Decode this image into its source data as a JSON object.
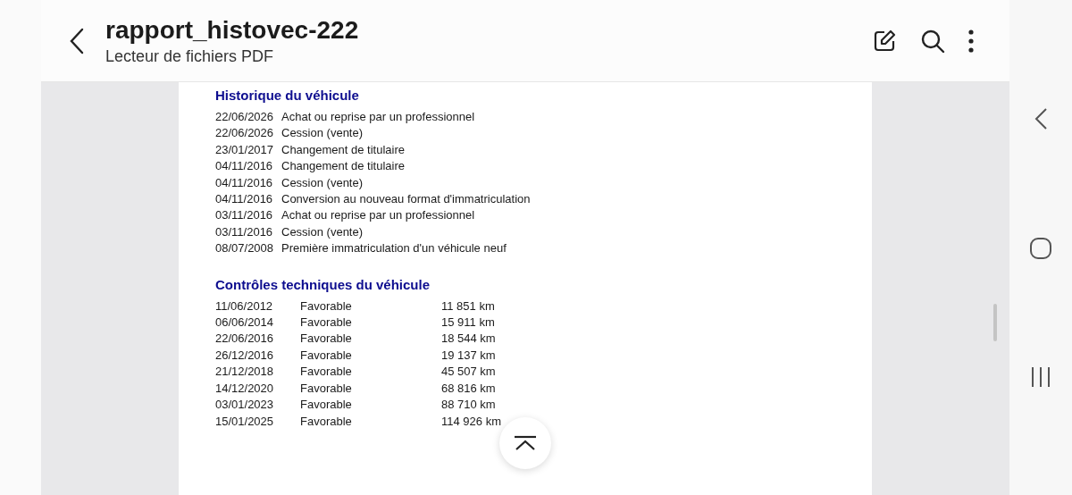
{
  "header": {
    "title": "rapport_histovec-222",
    "subtitle": "Lecteur de fichiers PDF"
  },
  "history": {
    "title": "Historique du véhicule",
    "rows": [
      {
        "date": "22/06/2026",
        "event": "Achat ou reprise par un professionnel"
      },
      {
        "date": "22/06/2026",
        "event": "Cession (vente)"
      },
      {
        "date": "23/01/2017",
        "event": "Changement de titulaire"
      },
      {
        "date": "04/11/2016",
        "event": "Changement de titulaire"
      },
      {
        "date": "04/11/2016",
        "event": "Cession (vente)"
      },
      {
        "date": "04/11/2016",
        "event": "Conversion au nouveau format d'immatriculation"
      },
      {
        "date": "03/11/2016",
        "event": "Achat ou reprise par un professionnel"
      },
      {
        "date": "03/11/2016",
        "event": "Cession (vente)"
      },
      {
        "date": "08/07/2008",
        "event": "Première immatriculation d'un véhicule neuf"
      }
    ]
  },
  "inspections": {
    "title": "Contrôles techniques du véhicule",
    "rows": [
      {
        "date": "11/06/2012",
        "result": "Favorable",
        "mileage": "11 851 km"
      },
      {
        "date": "06/06/2014",
        "result": "Favorable",
        "mileage": "15 911 km"
      },
      {
        "date": "22/06/2016",
        "result": "Favorable",
        "mileage": "18 544 km"
      },
      {
        "date": "26/12/2016",
        "result": "Favorable",
        "mileage": "19 137 km"
      },
      {
        "date": "21/12/2018",
        "result": "Favorable",
        "mileage": "45 507 km"
      },
      {
        "date": "14/12/2020",
        "result": "Favorable",
        "mileage": "68 816 km"
      },
      {
        "date": "03/01/2023",
        "result": "Favorable",
        "mileage": "88 710 km"
      },
      {
        "date": "15/01/2025",
        "result": "Favorable",
        "mileage": "114 926 km"
      }
    ]
  }
}
